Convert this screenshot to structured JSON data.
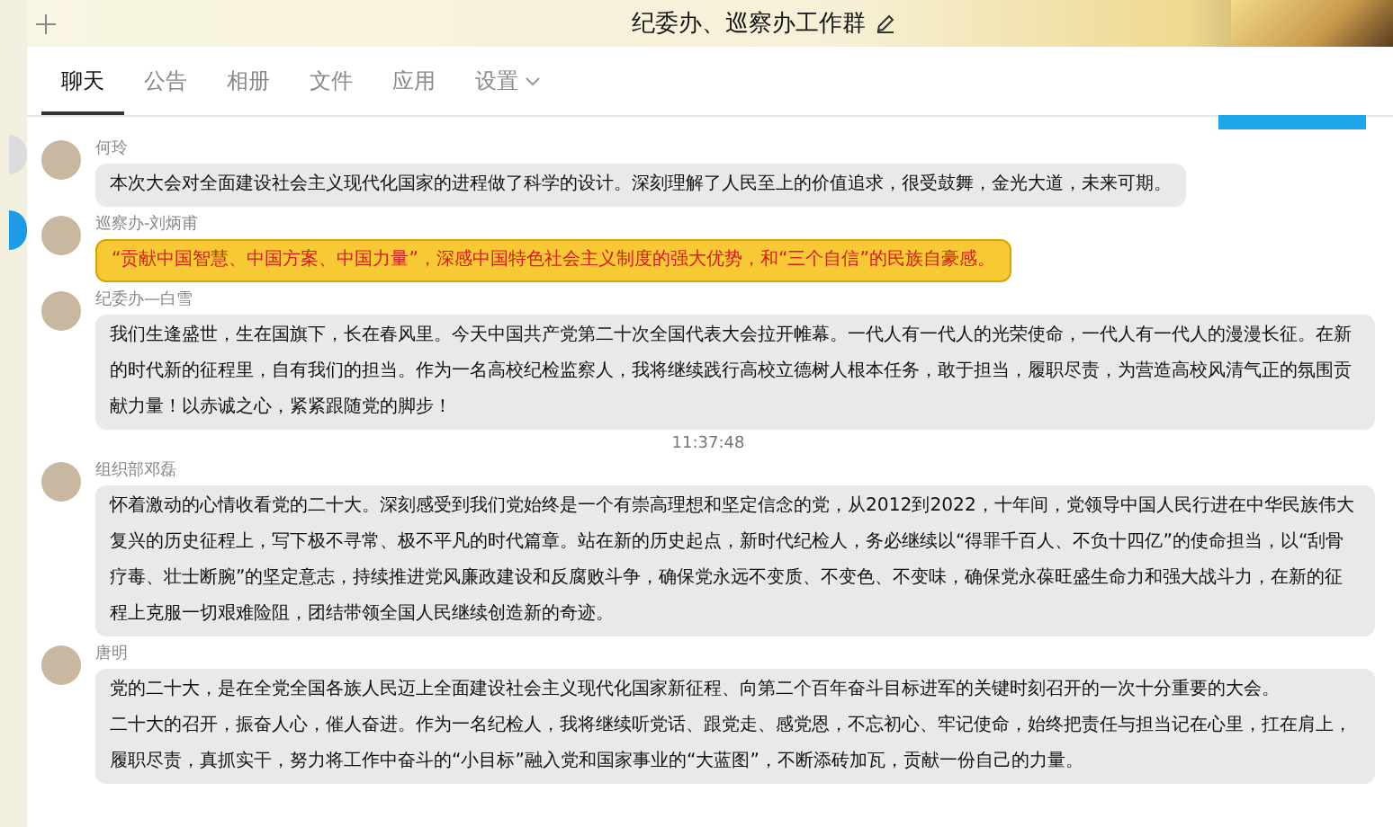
{
  "window": {
    "title": "纪委办、巡察办工作群"
  },
  "tabs": [
    {
      "label": "聊天",
      "selected": true
    },
    {
      "label": "公告",
      "selected": false
    },
    {
      "label": "相册",
      "selected": false
    },
    {
      "label": "文件",
      "selected": false
    },
    {
      "label": "应用",
      "selected": false
    },
    {
      "label": "设置",
      "selected": false,
      "dropdown": true
    }
  ],
  "messages": [
    {
      "kind": "message",
      "sender": "何玲",
      "text": "本次大会对全面建设社会主义现代化国家的进程做了科学的设计。深刻理解了人民至上的价值追求，很受鼓舞，金光大道，未来可期。"
    },
    {
      "kind": "highlight",
      "sender": "巡察办-刘炳甫",
      "text": "“贡献中国智慧、中国方案、中国力量”，深感中国特色社会主义制度的强大优势，和“三个自信”的民族自豪感。"
    },
    {
      "kind": "message",
      "sender": "纪委办—白雪",
      "text": "我们生逢盛世，生在国旗下，长在春风里。今天中国共产党第二十次全国代表大会拉开帷幕。一代人有一代人的光荣使命，一代人有一代人的漫漫长征。在新的时代新的征程里，自有我们的担当。作为一名高校纪检监察人，我将继续践行高校立德树人根本任务，敢于担当，履职尽责，为营造高校风清气正的氛围贡献力量！以赤诚之心，紧紧跟随党的脚步！"
    },
    {
      "kind": "time",
      "text": "11:37:48"
    },
    {
      "kind": "message",
      "sender": "组织部邓磊",
      "text": "怀着激动的心情收看党的二十大。深刻感受到我们党始终是一个有崇高理想和坚定信念的党，从2012到2022，十年间，党领导中国人民行进在中华民族伟大复兴的历史征程上，写下极不寻常、极不平凡的时代篇章。站在新的历史起点，新时代纪检人，务必继续以“得罪千百人、不负十四亿”的使命担当，以“刮骨疗毒、壮士断腕”的坚定意志，持续推进党风廉政建设和反腐败斗争，确保党永远不变质、不变色、不变味，确保党永葆旺盛生命力和强大战斗力，在新的征程上克服一切艰难险阻，团结带领全国人民继续创造新的奇迹。"
    },
    {
      "kind": "message",
      "sender": "唐明",
      "paragraphs": [
        "党的二十大，是在全党全国各族人民迈上全面建设社会主义现代化国家新征程、向第二个百年奋斗目标进军的关键时刻召开的一次十分重要的大会。",
        "二十大的召开，振奋人心，催人奋进。作为一名纪检人，我将继续听党话、跟党走、感党恩，不忘初心、牢记使命，始终把责任与担当记在心里，扛在肩上，履职尽责，真抓实干，努力将工作中奋斗的“小目标”融入党和国家事业的“大蓝图”，不断添砖加瓦，贡献一份自己的力量。"
      ]
    }
  ]
}
